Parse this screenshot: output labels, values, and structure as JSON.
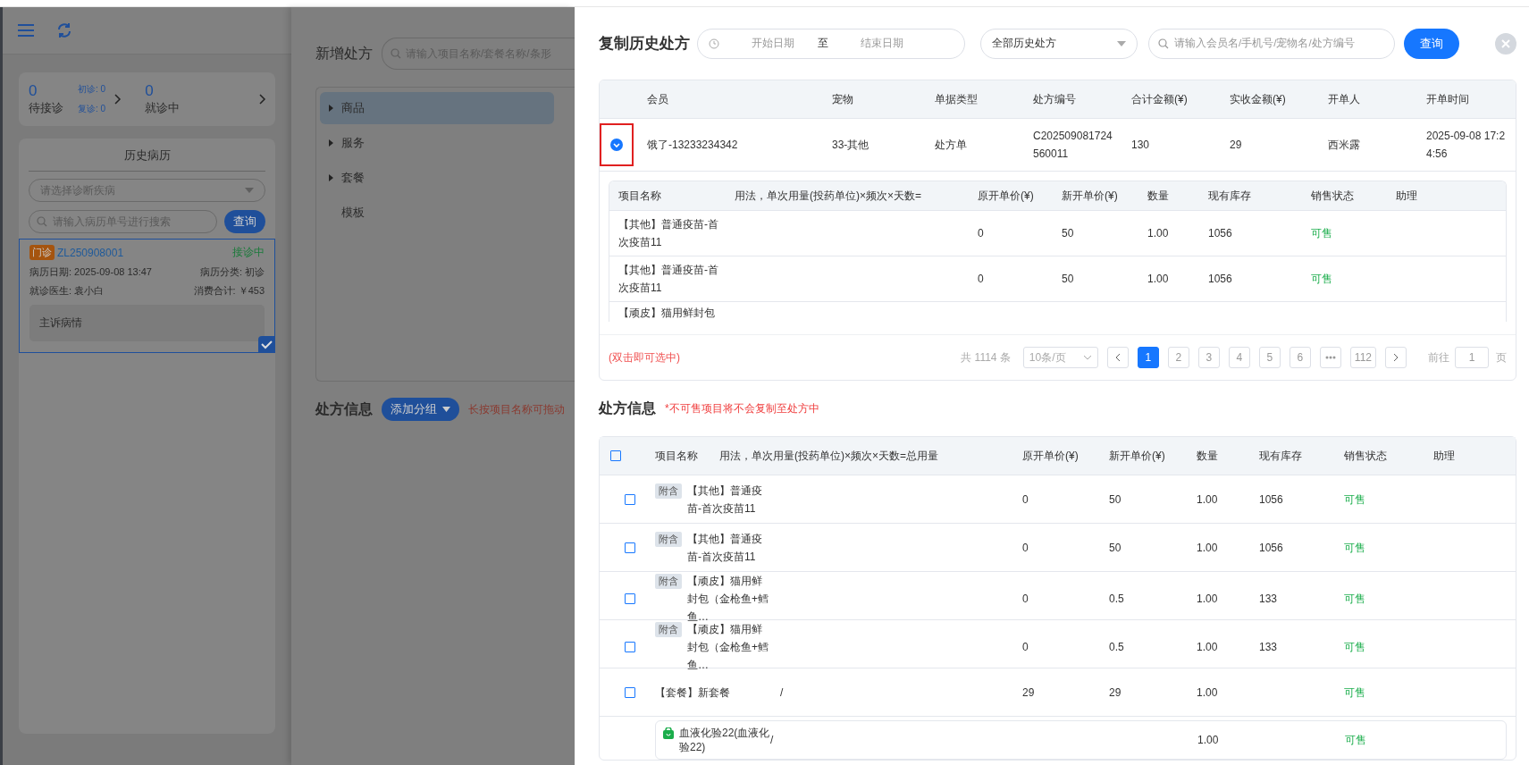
{
  "sidebar": {
    "stats": {
      "waiting": "0",
      "waiting_label": "待接诊",
      "first_visit": "初诊: 0",
      "return_visit": "复诊: 0",
      "in_progress": "0",
      "in_progress_label": "就诊中"
    },
    "history": {
      "title": "历史病历",
      "diagnosis_placeholder": "请选择诊断疾病",
      "search_placeholder": "请输入病历单号进行搜索",
      "search_button": "查询",
      "records": [
        {
          "tag": "门诊",
          "number": "ZL250908001",
          "status": "接诊中",
          "date": "病历日期: 2025-09-08 13:47",
          "category": "病历分类: 初诊",
          "doctor": "就诊医生: 袁小白",
          "total": "消费合计: ￥453",
          "complaint": "主诉病情",
          "selected": true
        }
      ]
    }
  },
  "prescription_editor": {
    "title": "新增处方",
    "search_placeholder": "请输入项目名称/套餐名称/条形",
    "categories": [
      {
        "label": "商品",
        "expandable": true,
        "selected": true
      },
      {
        "label": "服务",
        "expandable": true,
        "selected": false
      },
      {
        "label": "套餐",
        "expandable": true,
        "selected": false
      },
      {
        "label": "模板",
        "expandable": false,
        "selected": false
      }
    ],
    "info_title": "处方信息",
    "add_group_button": "添加分组",
    "hint": "长按项目名称可拖动"
  },
  "drawer": {
    "title": "复制历史处方",
    "start_placeholder": "开始日期",
    "separator": "至",
    "end_placeholder": "结束日期",
    "filter": "全部历史处方",
    "search_placeholder": "请输入会员名/手机号/宠物名/处方编号",
    "query_button": "查询",
    "history_table": {
      "columns": [
        "会员",
        "宠物",
        "单据类型",
        "处方编号",
        "合计金额(¥)",
        "实收金额(¥)",
        "开单人",
        "开单时间"
      ],
      "rows": [
        {
          "expanded": true,
          "highlighted": true,
          "cells": [
            "饿了-13233234342",
            "33-其他",
            "处方单",
            "C202509081724560011",
            "130",
            "29",
            "西米露",
            "2025-09-08 17:24:56"
          ],
          "items": {
            "columns": [
              "项目名称",
              "用法，单次用量(投药单位)×频次×天数=",
              "原开单价(¥)",
              "新开单价(¥)",
              "数量",
              "现有库存",
              "销售状态",
              "助理"
            ],
            "rows": [
              {
                "name": "【其他】普通疫苗-首次疫苗11",
                "original_price": "0",
                "new_price": "50",
                "quantity": "1.00",
                "stock": "1056",
                "status": "可售"
              },
              {
                "name": "【其他】普通疫苗-首次疫苗11",
                "original_price": "0",
                "new_price": "50",
                "quantity": "1.00",
                "stock": "1056",
                "status": "可售"
              },
              {
                "name": "【顽皮】猫用鲜封包"
              }
            ]
          }
        }
      ]
    },
    "pagination": {
      "hint": "(双击即可选中)",
      "total": "共 1114 条",
      "page_size": "10条/页",
      "pages": [
        {
          "label": "1",
          "selected": true
        },
        {
          "label": "2",
          "selected": false
        },
        {
          "label": "3",
          "selected": false
        },
        {
          "label": "4",
          "selected": false
        },
        {
          "label": "5",
          "selected": false
        },
        {
          "label": "6",
          "selected": false
        },
        {
          "label": "112",
          "selected": false
        }
      ],
      "goto_label": "前往",
      "goto_value": "1",
      "goto_suffix": "页"
    },
    "prescription_info": {
      "title": "处方信息",
      "note": "*不可售项目将不会复制至处方中",
      "all_checked": false,
      "columns": [
        "项目名称",
        "用法，单次用量(投药单位)×频次×天数=总用量",
        "原开单价(¥)",
        "新开单价(¥)",
        "数量",
        "现有库存",
        "销售状态",
        "助理"
      ],
      "rows": [
        {
          "kind": "item",
          "checked": false,
          "tag": "附含",
          "name": "【其他】普通疫苗-首次疫苗11",
          "original_price": "0",
          "new_price": "50",
          "quantity": "1.00",
          "stock": "1056",
          "status": "可售"
        },
        {
          "kind": "item",
          "checked": false,
          "tag": "附含",
          "name": "【其他】普通疫苗-首次疫苗11",
          "original_price": "0",
          "new_price": "50",
          "quantity": "1.00",
          "stock": "1056",
          "status": "可售"
        },
        {
          "kind": "item",
          "checked": false,
          "tag": "附含",
          "name": "【顽皮】猫用鲜封包（金枪鱼+鳕鱼…",
          "original_price": "0",
          "new_price": "0.5",
          "quantity": "1.00",
          "stock": "133",
          "status": "可售"
        },
        {
          "kind": "item",
          "checked": false,
          "tag": "附含",
          "name": "【顽皮】猫用鲜封包（金枪鱼+鳕鱼…",
          "original_price": "0",
          "new_price": "0.5",
          "quantity": "1.00",
          "stock": "133",
          "status": "可售"
        },
        {
          "kind": "package",
          "checked": false,
          "name": "【套餐】新套餐",
          "usage": "/",
          "original_price": "29",
          "new_price": "29",
          "quantity": "1.00",
          "status": "可售"
        },
        {
          "kind": "sub",
          "name": "血液化验22(血液化验22)",
          "usage": "/",
          "quantity": "1.00",
          "status": "可售"
        }
      ]
    }
  }
}
